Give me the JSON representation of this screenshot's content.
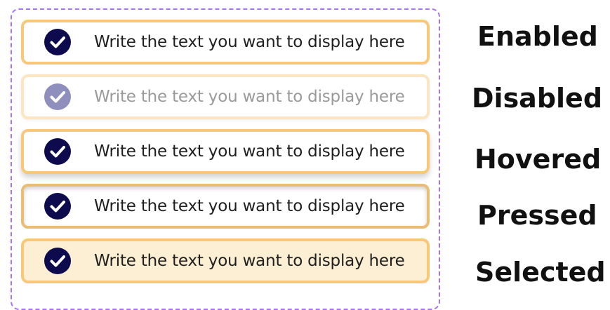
{
  "items": [
    {
      "state": "enabled",
      "text": "Write the text you want to display here",
      "icon": "check-circle-icon",
      "icon_color": "#0d0b4d"
    },
    {
      "state": "disabled",
      "text": "Write the text you want to display here",
      "icon": "check-circle-icon",
      "icon_color": "#8f8fbd"
    },
    {
      "state": "hovered",
      "text": "Write the text you want to display here",
      "icon": "check-circle-icon",
      "icon_color": "#0d0b4d"
    },
    {
      "state": "pressed",
      "text": "Write the text you want to display here",
      "icon": "check-circle-icon",
      "icon_color": "#0d0b4d"
    },
    {
      "state": "selected",
      "text": "Write the text you want to display here",
      "icon": "check-circle-icon",
      "icon_color": "#0d0b4d"
    }
  ],
  "labels": {
    "enabled": "Enabled",
    "disabled": "Disabled",
    "hovered": "Hovered",
    "pressed": "Pressed",
    "selected": "Selected"
  },
  "colors": {
    "frame_border": "#a774f0",
    "item_border": "#f8c878",
    "item_border_disabled": "#fbe6c1",
    "selected_background": "#fdefd4"
  }
}
